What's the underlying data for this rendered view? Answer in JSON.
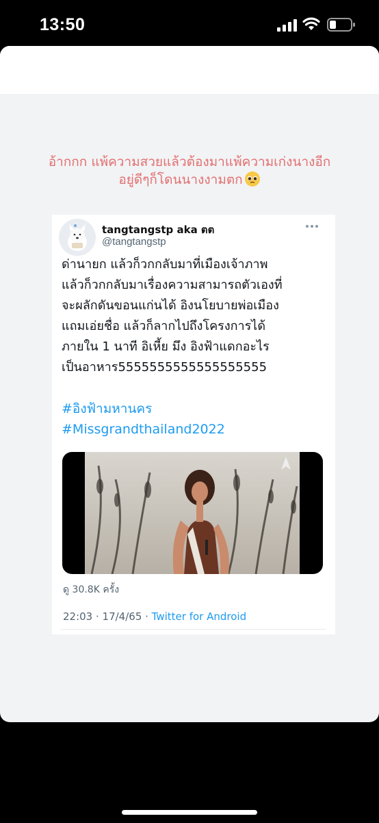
{
  "status_bar": {
    "time": "13:50",
    "icons": [
      "signal-icon",
      "wifi-icon",
      "battery-icon"
    ]
  },
  "story": {
    "caption_line1": "อ้ากกก  แพ้ความสวยแล้วต้องมาแพ้ความเก่งนางอีก",
    "caption_line2": "อยู่ดีๆก็โดนนางงามตก",
    "caption_emoji": "pleading-face-emoji",
    "caption_color": "#e36f6f"
  },
  "tweet": {
    "display_name": "tangtangstp aka ตต",
    "handle": "@tangtangstp",
    "lines": [
      "ด่านายก แล้วก็วกกลับมาที่เมืองเจ้าภาพ",
      "แล้วก็วกกลับมาเรื่องความสามารถตัวเองที่",
      "จะผลักดันขอนแก่นได้ อิงนโยบายพ่อเมือง",
      "แถมเอ่ยชื่อ แล้วก็ลากไปถึงโครงการได้",
      "ภายใน 1 นาที อิเหี้ย มึง อิงฟ้าแดกอะไร",
      "เป็นอาหาร5555555555555555555"
    ],
    "hashtags": [
      "#อิงฟ้ามหานคร",
      "#Missgrandthailand2022"
    ],
    "views": "ดู 30.8K ครั้ง",
    "timestamp": "22:03 · 17/4/65 · ",
    "source": "Twitter for Android",
    "link_color": "#1d9bf0"
  }
}
